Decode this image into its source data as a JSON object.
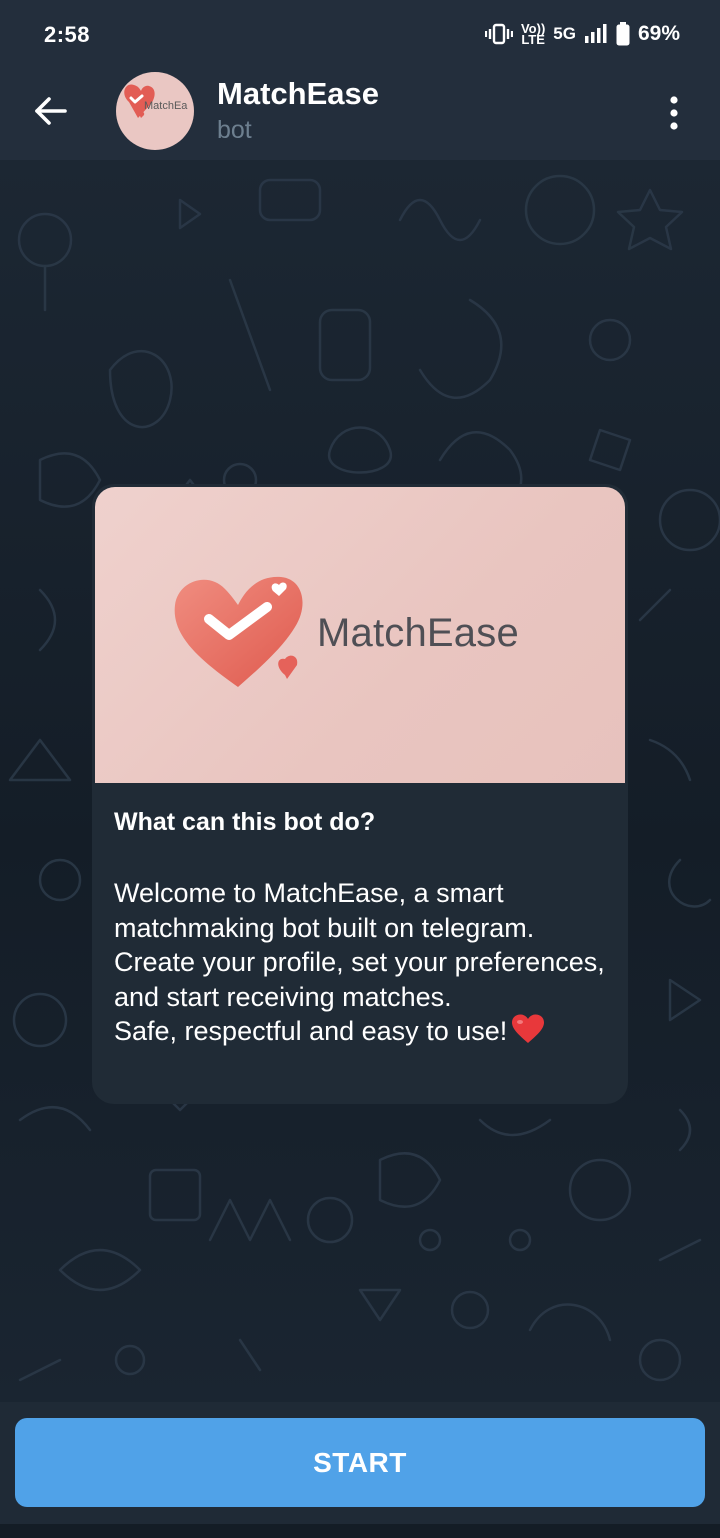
{
  "status_bar": {
    "time": "2:58",
    "network_top": "Vo))",
    "network_bottom": "LTE",
    "network_type": "5G",
    "battery": "69%"
  },
  "header": {
    "title": "MatchEase",
    "subtitle": "bot",
    "avatar_text": "MatchEa"
  },
  "bot_card": {
    "logo_text": "MatchEase",
    "heading": "What can this bot do?",
    "body_lines": [
      "Welcome to MatchEase, a smart matchmaking bot built on telegram.",
      "Create your profile, set your preferences, and start receiving matches.",
      "Safe, respectful and easy to use!"
    ]
  },
  "bottom": {
    "start_label": "START"
  },
  "colors": {
    "header_bg": "#232e3c",
    "accent": "#50a2e8",
    "card_bg": "#202b36",
    "logo_pink": "#e9c5c0",
    "heart_red": "#ea6a5e"
  },
  "icons": [
    "back-arrow-icon",
    "more-vertical-icon",
    "vibrate-icon",
    "signal-icon",
    "battery-icon",
    "heart-logo-icon",
    "red-heart-emoji-icon"
  ]
}
